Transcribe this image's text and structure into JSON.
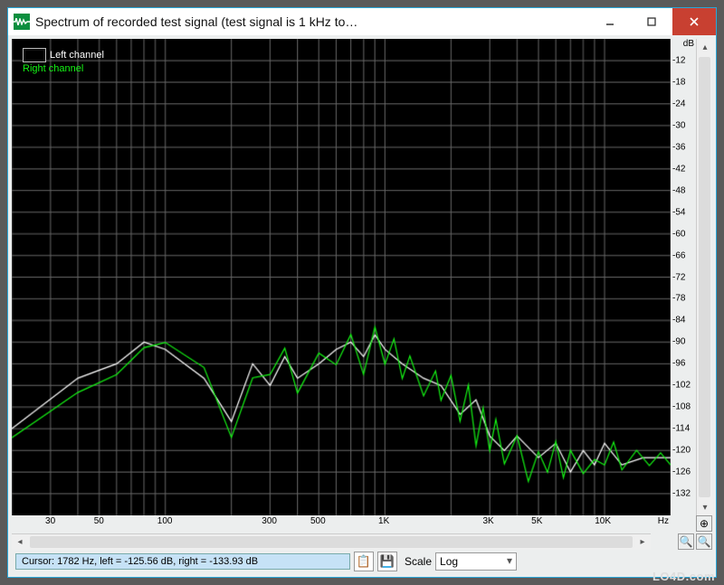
{
  "window": {
    "title": "Spectrum of recorded test signal (test signal is 1 kHz to…"
  },
  "legend": {
    "left": "Left channel",
    "right": "Right channel"
  },
  "axis": {
    "y_unit": "dB",
    "x_unit": "Hz",
    "y_ticks_text": [
      "-12",
      "-18",
      "-24",
      "-30",
      "-36",
      "-42",
      "-48",
      "-54",
      "-60",
      "-66",
      "-72",
      "-78",
      "-84",
      "-90",
      "-96",
      "-102",
      "-108",
      "-114",
      "-120",
      "-126",
      "-132"
    ],
    "x_ticks_text": [
      "30",
      "50",
      "100",
      "300",
      "500",
      "1K",
      "3K",
      "5K",
      "10K"
    ]
  },
  "footer": {
    "cursor": "Cursor:  1782 Hz,  left = -125.56 dB,  right = -133.93 dB",
    "scale_label": "Scale",
    "scale_value": "Log"
  },
  "icons": {
    "save": "💾",
    "zoom_in": "⊕",
    "zoom_out": "⊖",
    "mag": "🔍"
  },
  "watermark": "LO4D.com",
  "chart_data": {
    "type": "line",
    "title": "Spectrum of recorded test signal",
    "xlabel": "Hz",
    "ylabel": "dB",
    "xscale": "log",
    "xlim": [
      20,
      20000
    ],
    "ylim": [
      -138,
      -6
    ],
    "x_ticks": [
      30,
      50,
      100,
      300,
      500,
      1000,
      3000,
      5000,
      10000
    ],
    "y_ticks": [
      -12,
      -18,
      -24,
      -30,
      -36,
      -42,
      -48,
      -54,
      -60,
      -66,
      -72,
      -78,
      -84,
      -90,
      -96,
      -102,
      -108,
      -114,
      -120,
      -126,
      -132
    ],
    "series": [
      {
        "name": "Left channel",
        "color": "#ffffff",
        "points": [
          [
            20,
            -114
          ],
          [
            40,
            -100
          ],
          [
            60,
            -96
          ],
          [
            80,
            -90
          ],
          [
            100,
            -92
          ],
          [
            150,
            -100
          ],
          [
            200,
            -112
          ],
          [
            250,
            -96
          ],
          [
            300,
            -102
          ],
          [
            350,
            -94
          ],
          [
            400,
            -100
          ],
          [
            500,
            -96
          ],
          [
            600,
            -92
          ],
          [
            700,
            -90
          ],
          [
            800,
            -94
          ],
          [
            900,
            -88
          ],
          [
            1000,
            -92
          ],
          [
            1200,
            -96
          ],
          [
            1500,
            -100
          ],
          [
            1800,
            -102
          ],
          [
            2200,
            -110
          ],
          [
            2600,
            -106
          ],
          [
            3000,
            -116
          ],
          [
            3500,
            -120
          ],
          [
            4000,
            -116
          ],
          [
            5000,
            -122
          ],
          [
            6000,
            -118
          ],
          [
            7000,
            -126
          ],
          [
            8000,
            -120
          ],
          [
            9000,
            -124
          ],
          [
            10000,
            -118
          ],
          [
            12000,
            -124
          ],
          [
            15000,
            -122
          ],
          [
            20000,
            -122
          ]
        ]
      },
      {
        "name": "Right channel",
        "color": "#14f514",
        "points": [
          [
            20,
            -116
          ],
          [
            40,
            -104
          ],
          [
            60,
            -98
          ],
          [
            80,
            -92
          ],
          [
            100,
            -90
          ],
          [
            150,
            -98
          ],
          [
            200,
            -116
          ],
          [
            250,
            -100
          ],
          [
            300,
            -98
          ],
          [
            350,
            -92
          ],
          [
            400,
            -104
          ],
          [
            500,
            -94
          ],
          [
            600,
            -96
          ],
          [
            700,
            -88
          ],
          [
            800,
            -98
          ],
          [
            900,
            -86
          ],
          [
            1000,
            -96
          ],
          [
            1100,
            -90
          ],
          [
            1200,
            -100
          ],
          [
            1300,
            -94
          ],
          [
            1500,
            -104
          ],
          [
            1700,
            -98
          ],
          [
            1800,
            -106
          ],
          [
            2000,
            -100
          ],
          [
            2200,
            -112
          ],
          [
            2400,
            -102
          ],
          [
            2600,
            -118
          ],
          [
            2800,
            -108
          ],
          [
            3000,
            -120
          ],
          [
            3200,
            -112
          ],
          [
            3500,
            -124
          ],
          [
            4000,
            -116
          ],
          [
            4500,
            -128
          ],
          [
            5000,
            -120
          ],
          [
            5500,
            -126
          ],
          [
            6000,
            -118
          ],
          [
            6500,
            -128
          ],
          [
            7000,
            -120
          ],
          [
            8000,
            -126
          ],
          [
            9000,
            -122
          ],
          [
            10000,
            -124
          ],
          [
            11000,
            -118
          ],
          [
            12000,
            -126
          ],
          [
            14000,
            -120
          ],
          [
            16000,
            -124
          ],
          [
            18000,
            -120
          ],
          [
            20000,
            -124
          ]
        ]
      }
    ]
  }
}
